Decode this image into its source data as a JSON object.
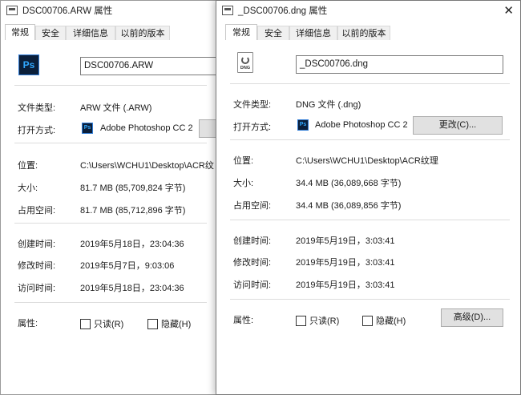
{
  "left": {
    "title": "DSC00706.ARW 属性",
    "tabs": [
      "常规",
      "安全",
      "详细信息",
      "以前的版本"
    ],
    "icon": "photoshop-icon",
    "filename": "DSC00706.ARW",
    "type_label": "文件类型:",
    "type_value": "ARW 文件 (.ARW)",
    "open_label": "打开方式:",
    "open_app": "Adobe Photoshop CC 2",
    "location_label": "位置:",
    "location_value": "C:\\Users\\WCHU1\\Desktop\\ACR纹",
    "size_label": "大小:",
    "size_value": "81.7 MB (85,709,824 字节)",
    "disk_label": "占用空间:",
    "disk_value": "81.7 MB (85,712,896 字节)",
    "created_label": "创建时间:",
    "created_value": "2019年5月18日，23:04:36",
    "modified_label": "修改时间:",
    "modified_value": "2019年5月7日，9:03:06",
    "accessed_label": "访问时间:",
    "accessed_value": "2019年5月18日，23:04:36",
    "attr_label": "属性:",
    "readonly": "只读(R)",
    "hidden": "隐藏(H)"
  },
  "right": {
    "title": "_DSC00706.dng 属性",
    "close_glyph": "✕",
    "tabs": [
      "常规",
      "安全",
      "详细信息",
      "以前的版本"
    ],
    "icon": "dng-file-icon",
    "icon_text": "DNG",
    "filename": "_DSC00706.dng",
    "type_label": "文件类型:",
    "type_value": "DNG 文件 (.dng)",
    "open_label": "打开方式:",
    "open_app": "Adobe Photoshop CC 2",
    "change_button": "更改(C)...",
    "location_label": "位置:",
    "location_value": "C:\\Users\\WCHU1\\Desktop\\ACR纹理",
    "size_label": "大小:",
    "size_value": "34.4 MB (36,089,668 字节)",
    "disk_label": "占用空间:",
    "disk_value": "34.4 MB (36,089,856 字节)",
    "created_label": "创建时间:",
    "created_value": "2019年5月19日，3:03:41",
    "modified_label": "修改时间:",
    "modified_value": "2019年5月19日，3:03:41",
    "accessed_label": "访问时间:",
    "accessed_value": "2019年5月19日，3:03:41",
    "attr_label": "属性:",
    "readonly": "只读(R)",
    "hidden": "隐藏(H)",
    "advanced_button": "高级(D)..."
  },
  "ps_icon_text": "Ps"
}
